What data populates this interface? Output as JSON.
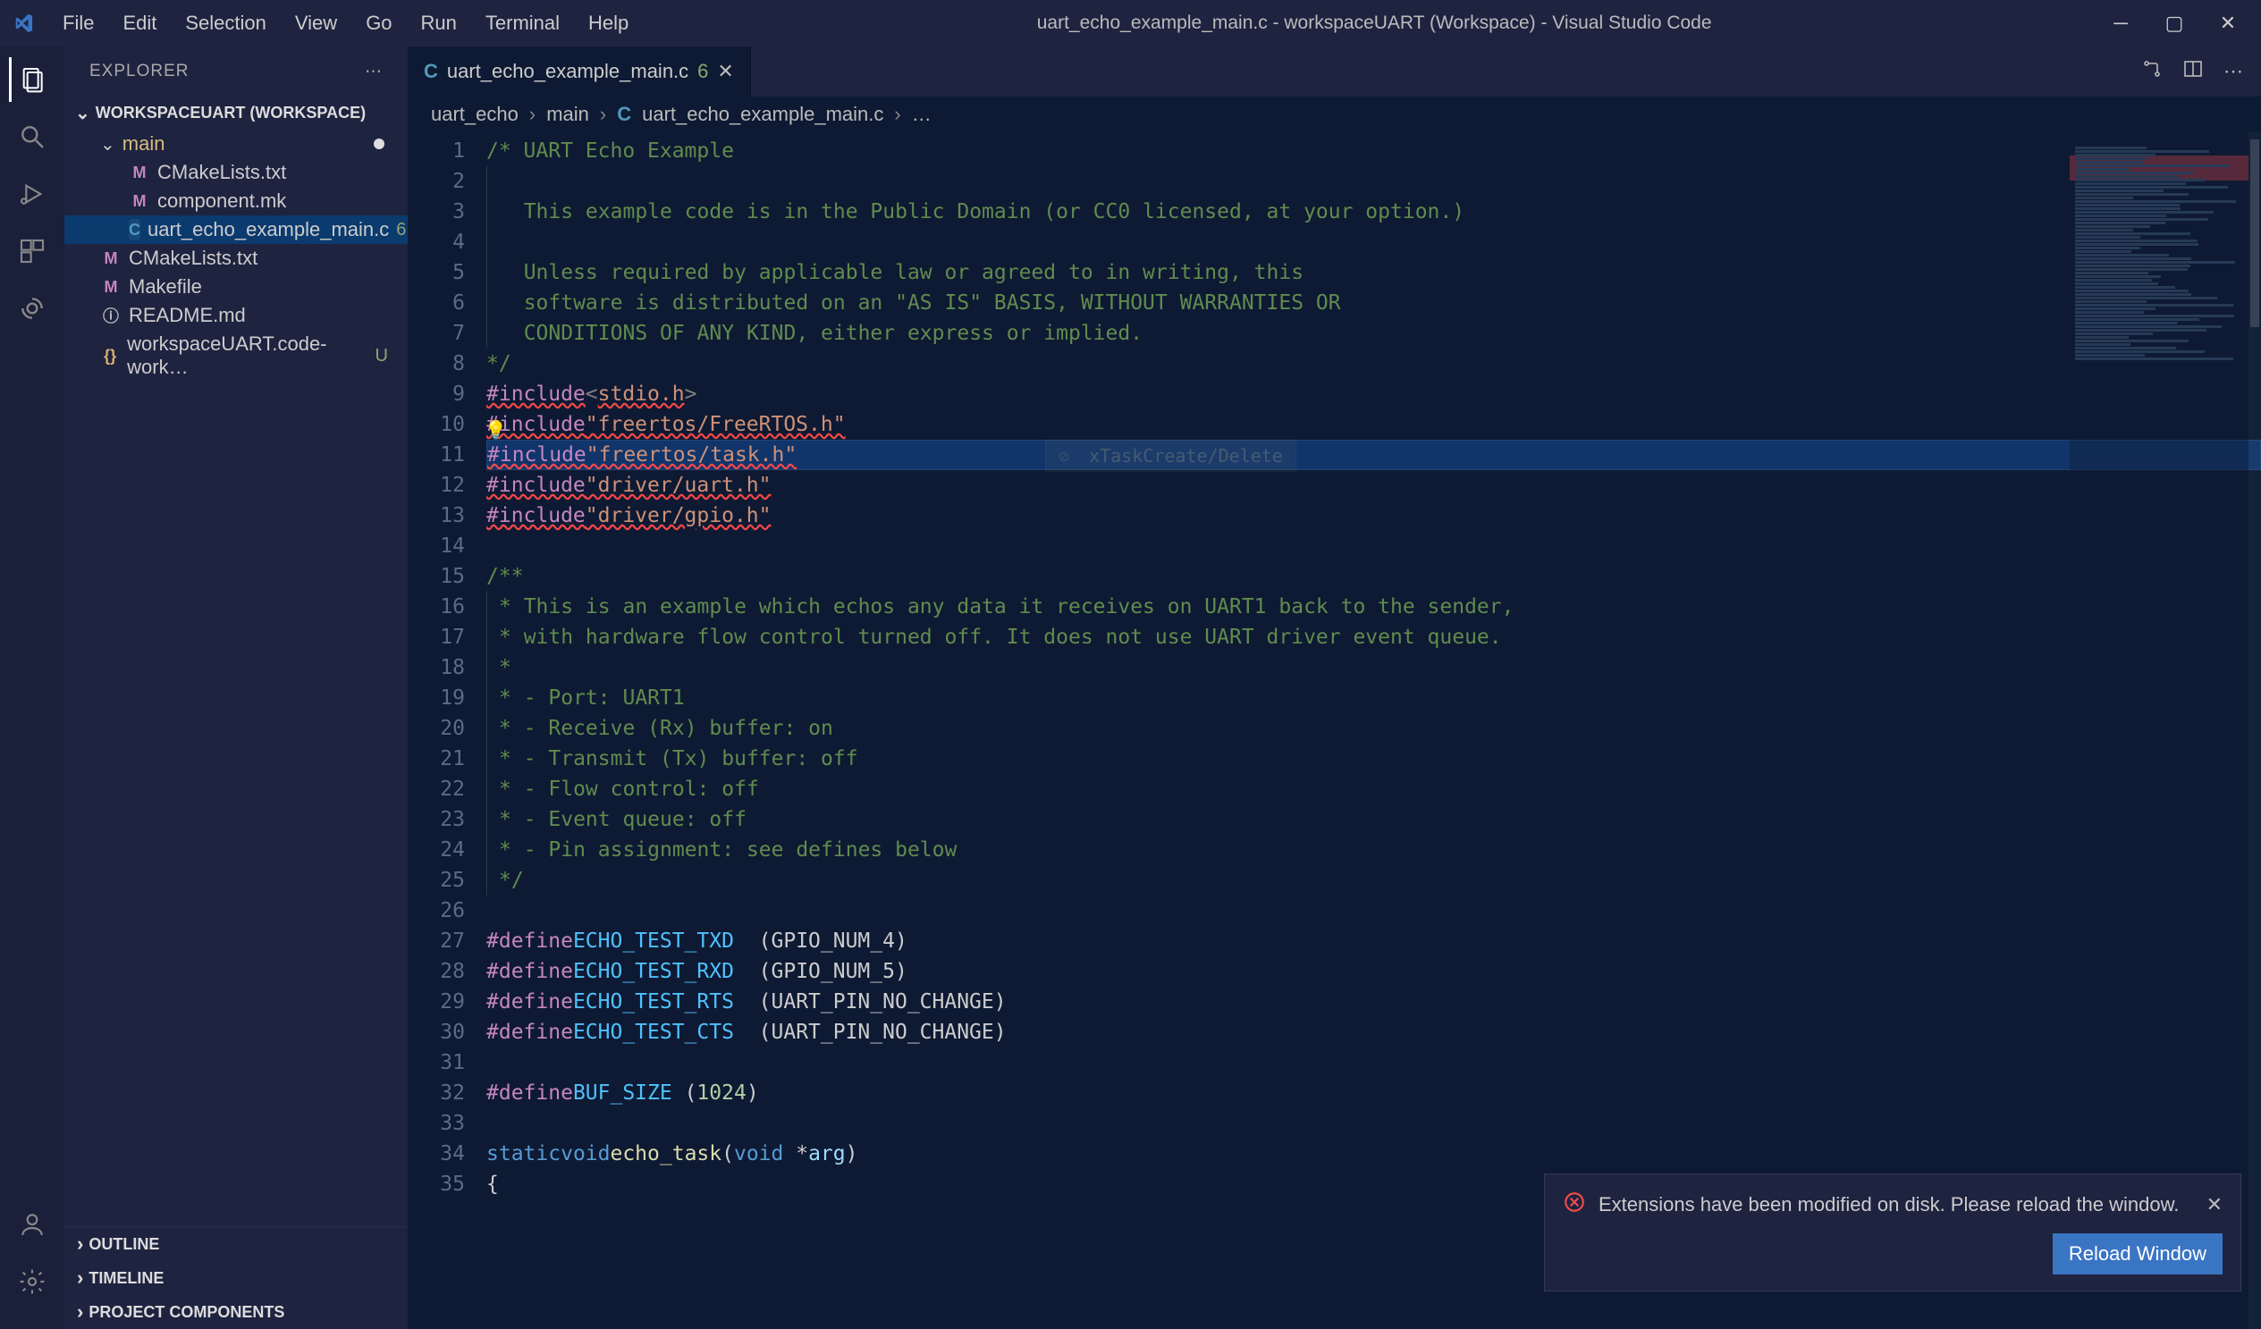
{
  "menu": [
    "File",
    "Edit",
    "Selection",
    "View",
    "Go",
    "Run",
    "Terminal",
    "Help"
  ],
  "window_title": "uart_echo_example_main.c - workspaceUART (Workspace) - Visual Studio Code",
  "sidebar": {
    "title": "EXPLORER",
    "workspace": "WORKSPACEUART (WORKSPACE)",
    "tree": [
      {
        "type": "folder",
        "name": "main",
        "open": true,
        "modified": true,
        "indent": 1
      },
      {
        "type": "file",
        "name": "CMakeLists.txt",
        "icon": "M",
        "indent": 2
      },
      {
        "type": "file",
        "name": "component.mk",
        "icon": "M",
        "indent": 2
      },
      {
        "type": "file",
        "name": "uart_echo_example_main.c",
        "icon": "C",
        "badge": "6",
        "selected": true,
        "indent": 2
      },
      {
        "type": "file",
        "name": "CMakeLists.txt",
        "icon": "M",
        "indent": 1
      },
      {
        "type": "file",
        "name": "Makefile",
        "icon": "M",
        "indent": 1
      },
      {
        "type": "file",
        "name": "README.md",
        "icon": "ⓘ",
        "indent": 1
      },
      {
        "type": "file",
        "name": "workspaceUART.code-work…",
        "icon": "{}",
        "badge": "U",
        "indent": 1
      }
    ],
    "sections": [
      "OUTLINE",
      "TIMELINE",
      "PROJECT COMPONENTS"
    ]
  },
  "tab": {
    "icon": "C",
    "label": "uart_echo_example_main.c",
    "badge": "6"
  },
  "breadcrumbs": [
    "uart_echo",
    "main",
    "uart_echo_example_main.c",
    "…"
  ],
  "code_lines": [
    {
      "n": 1,
      "html": "<span class='c-comment'>/* UART Echo Example</span>"
    },
    {
      "n": 2,
      "html": "<span class='indent-guide'></span>"
    },
    {
      "n": 3,
      "html": "<span class='indent-guide'></span><span class='c-comment'>  This example code is in the Public Domain (or CC0 licensed, at your option.)</span>"
    },
    {
      "n": 4,
      "html": "<span class='indent-guide'></span>"
    },
    {
      "n": 5,
      "html": "<span class='indent-guide'></span><span class='c-comment'>  Unless required by applicable law or agreed to in writing, this</span>"
    },
    {
      "n": 6,
      "html": "<span class='indent-guide'></span><span class='c-comment'>  software is distributed on an \"AS IS\" BASIS, WITHOUT WARRANTIES OR</span>"
    },
    {
      "n": 7,
      "html": "<span class='indent-guide'></span><span class='c-comment'>  CONDITIONS OF ANY KIND, either express or implied.</span>"
    },
    {
      "n": 8,
      "html": "<span class='c-comment'>*/</span>"
    },
    {
      "n": 9,
      "html": "<span class='c-pp squiggle'>#include</span> <span class='c-angle'>&lt;</span><span class='c-string squiggle'>stdio.h</span><span class='c-angle'>&gt;</span>"
    },
    {
      "n": 10,
      "bulb": true,
      "html": "<span class='c-pp squiggle'>#include</span> <span class='c-string squiggle'>\"freertos/FreeRTOS.h\"</span>"
    },
    {
      "n": 11,
      "hl": true,
      "hint": true,
      "html": "<span class='c-pp squiggle'>#include</span> <span class='c-string squiggle'>\"freertos/task.h\"</span>"
    },
    {
      "n": 12,
      "html": "<span class='c-pp squiggle'>#include</span> <span class='c-string squiggle'>\"driver/uart.h\"</span>"
    },
    {
      "n": 13,
      "html": "<span class='c-pp squiggle'>#include</span> <span class='c-string squiggle'>\"driver/gpio.h\"</span>"
    },
    {
      "n": 14,
      "html": ""
    },
    {
      "n": 15,
      "html": "<span class='c-comment'>/**</span>"
    },
    {
      "n": 16,
      "html": "<span class='indent-guide'></span><span class='c-comment'>* This is an example which echos any data it receives on UART1 back to the sender,</span>"
    },
    {
      "n": 17,
      "html": "<span class='indent-guide'></span><span class='c-comment'>* with hardware flow control turned off. It does not use UART driver event queue.</span>"
    },
    {
      "n": 18,
      "html": "<span class='indent-guide'></span><span class='c-comment'>*</span>"
    },
    {
      "n": 19,
      "html": "<span class='indent-guide'></span><span class='c-comment'>* - Port: UART1</span>"
    },
    {
      "n": 20,
      "html": "<span class='indent-guide'></span><span class='c-comment'>* - Receive (Rx) buffer: on</span>"
    },
    {
      "n": 21,
      "html": "<span class='indent-guide'></span><span class='c-comment'>* - Transmit (Tx) buffer: off</span>"
    },
    {
      "n": 22,
      "html": "<span class='indent-guide'></span><span class='c-comment'>* - Flow control: off</span>"
    },
    {
      "n": 23,
      "html": "<span class='indent-guide'></span><span class='c-comment'>* - Event queue: off</span>"
    },
    {
      "n": 24,
      "html": "<span class='indent-guide'></span><span class='c-comment'>* - Pin assignment: see defines below</span>"
    },
    {
      "n": 25,
      "html": "<span class='indent-guide'></span><span class='c-comment'>*/</span>"
    },
    {
      "n": 26,
      "html": ""
    },
    {
      "n": 27,
      "html": "<span class='c-pp'>#define</span> <span class='c-macro'>ECHO_TEST_TXD</span>  (GPIO_NUM_4)"
    },
    {
      "n": 28,
      "html": "<span class='c-pp'>#define</span> <span class='c-macro'>ECHO_TEST_RXD</span>  (GPIO_NUM_5)"
    },
    {
      "n": 29,
      "html": "<span class='c-pp'>#define</span> <span class='c-macro'>ECHO_TEST_RTS</span>  (UART_PIN_NO_CHANGE)"
    },
    {
      "n": 30,
      "html": "<span class='c-pp'>#define</span> <span class='c-macro'>ECHO_TEST_CTS</span>  (UART_PIN_NO_CHANGE)"
    },
    {
      "n": 31,
      "html": ""
    },
    {
      "n": 32,
      "html": "<span class='c-pp'>#define</span> <span class='c-macro'>BUF_SIZE</span> (<span class='c-num'>1024</span>)"
    },
    {
      "n": 33,
      "html": ""
    },
    {
      "n": 34,
      "html": "<span class='c-keyword'>static</span> <span class='c-keyword'>void</span> <span class='c-func'>echo_task</span>(<span class='c-keyword'>void</span> *<span class='c-param'>arg</span>)"
    },
    {
      "n": 35,
      "html": "{"
    }
  ],
  "notification": {
    "message": "Extensions have been modified on disk. Please reload the window.",
    "button": "Reload Window"
  },
  "hint_label": "xTaskCreate/Delete"
}
